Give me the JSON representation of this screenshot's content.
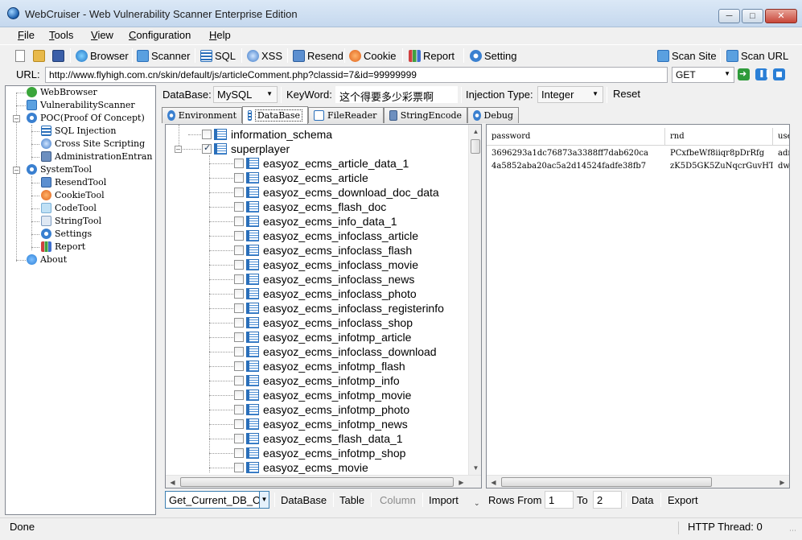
{
  "window": {
    "title": "WebCruiser - Web Vulnerability Scanner Enterprise Edition"
  },
  "menu": [
    {
      "label": "File",
      "key": "F",
      "rest": "ile"
    },
    {
      "label": "Tools",
      "key": "T",
      "rest": "ools"
    },
    {
      "label": "View",
      "key": "V",
      "rest": "iew"
    },
    {
      "label": "Configuration",
      "key": "C",
      "rest": "onfiguration"
    },
    {
      "label": "Help",
      "key": "H",
      "rest": "elp"
    }
  ],
  "toolbar": {
    "browser": "Browser",
    "scanner": "Scanner",
    "sql": "SQL",
    "xss": "XSS",
    "resend": "Resend",
    "cookie": "Cookie",
    "report": "Report",
    "setting": "Setting",
    "scan_site": "Scan Site",
    "scan_url": "Scan URL"
  },
  "url_bar": {
    "label": "URL:",
    "value": "http://www.flyhigh.com.cn/skin/default/js/articleComment.php?classid=7&id=99999999",
    "method": "GET"
  },
  "nav_tree": [
    {
      "label": "WebBrowser",
      "icon": "check-circle-icon"
    },
    {
      "label": "VulnerabilityScanner",
      "icon": "scanner-icon"
    },
    {
      "label": "POC(Proof Of Concept)",
      "icon": "gear-icon"
    },
    {
      "label": "SQL Injection",
      "icon": "database-icon"
    },
    {
      "label": "Cross Site Scripting",
      "icon": "xss-icon"
    },
    {
      "label": "AdministrationEntran",
      "icon": "admin-icon"
    },
    {
      "label": "SystemTool",
      "icon": "gear-icon"
    },
    {
      "label": "ResendTool",
      "icon": "resend-icon"
    },
    {
      "label": "CookieTool",
      "icon": "cookie-icon"
    },
    {
      "label": "CodeTool",
      "icon": "code-icon"
    },
    {
      "label": "StringTool",
      "icon": "string-icon"
    },
    {
      "label": "Settings",
      "icon": "settings-icon"
    },
    {
      "label": "Report",
      "icon": "report-icon"
    },
    {
      "label": "About",
      "icon": "help-icon"
    }
  ],
  "db_bar": {
    "database_label": "DataBase:",
    "database_value": "MySQL",
    "keyword_label": "KeyWord:",
    "keyword_value": "这个得要多少彩票啊",
    "injection_label": "Injection Type:",
    "injection_value": "Integer",
    "reset": "Reset"
  },
  "tabs": [
    "Environment",
    "DataBase",
    "FileReader",
    "StringEncode",
    "Debug"
  ],
  "db_tree": {
    "schema": "information_schema",
    "database": "superplayer",
    "tables": [
      "easyoz_ecms_article_data_1",
      "easyoz_ecms_article",
      "easyoz_ecms_download_doc_data",
      "easyoz_ecms_flash_doc",
      "easyoz_ecms_info_data_1",
      "easyoz_ecms_infoclass_article",
      "easyoz_ecms_infoclass_flash",
      "easyoz_ecms_infoclass_movie",
      "easyoz_ecms_infoclass_news",
      "easyoz_ecms_infoclass_photo",
      "easyoz_ecms_infoclass_registerinfo",
      "easyoz_ecms_infoclass_shop",
      "easyoz_ecms_infotmp_article",
      "easyoz_ecms_infoclass_download",
      "easyoz_ecms_infotmp_flash",
      "easyoz_ecms_infotmp_info",
      "easyoz_ecms_infotmp_movie",
      "easyoz_ecms_infotmp_photo",
      "easyoz_ecms_infotmp_news",
      "easyoz_ecms_flash_data_1",
      "easyoz_ecms_infotmp_shop",
      "easyoz_ecms_movie"
    ]
  },
  "grid": {
    "columns": [
      "password",
      "rnd",
      "use"
    ],
    "rows": [
      [
        "3696293a1dc76873a3388ff7dab620ca",
        "PCxfbeWf8iiqr8pDrRfg",
        "adm"
      ],
      [
        "4a5852aba20ac5a2d14524fadfe38fb7",
        "zK5D5GK5ZuNqcrGuvHTf",
        "dw_"
      ]
    ]
  },
  "bottom_bar": {
    "action": "Get_Current_DB_O",
    "database": "DataBase",
    "table": "Table",
    "column": "Column",
    "import": "Import",
    "rows_from": "Rows From",
    "from_value": "1",
    "to": "To",
    "to_value": "2",
    "data": "Data",
    "export": "Export"
  },
  "status": {
    "text": "Done",
    "thread": "HTTP Thread: 0"
  }
}
